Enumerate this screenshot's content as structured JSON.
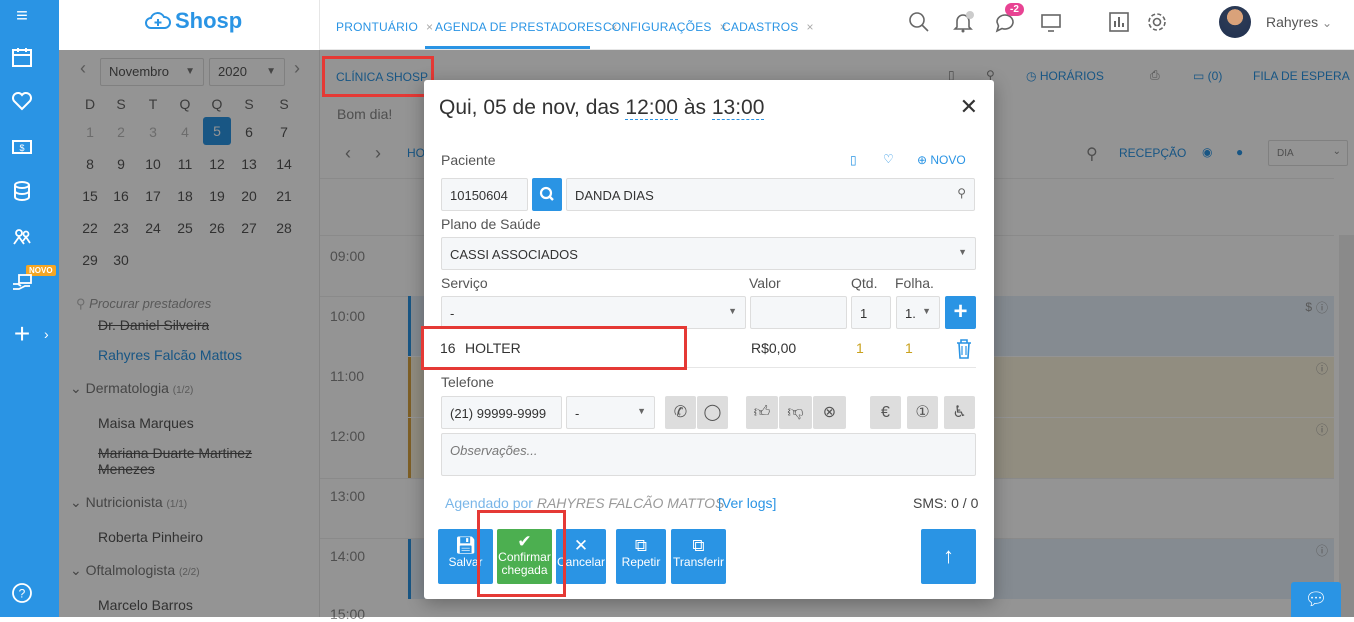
{
  "app": {
    "logo_text": "Shosp",
    "accent": "#2a94e4"
  },
  "rail": {
    "novo_badge": "NOVO"
  },
  "tabs": [
    {
      "label": "PRONTUÁRIO"
    },
    {
      "label": "AGENDA DE PRESTADORES"
    },
    {
      "label": "CONFIGURAÇÕES"
    },
    {
      "label": "CADASTROS"
    }
  ],
  "header": {
    "messages_badge": "-2",
    "user_name": "Rahyres"
  },
  "calendar": {
    "month": "Novembro",
    "year": "2020",
    "weekdays": [
      "D",
      "S",
      "T",
      "Q",
      "Q",
      "S",
      "S"
    ],
    "days": [
      "1",
      "2",
      "3",
      "4",
      "5",
      "6",
      "7",
      "8",
      "9",
      "10",
      "11",
      "12",
      "13",
      "14",
      "15",
      "16",
      "17",
      "18",
      "19",
      "20",
      "21",
      "22",
      "23",
      "24",
      "25",
      "26",
      "27",
      "28",
      "29",
      "30"
    ],
    "selected_day": "5"
  },
  "sidebar": {
    "search_placeholder": "Procurar prestadores",
    "provider_cut": "Dr. Daniel Silveira",
    "provider_active": "Rahyres Falcão Mattos",
    "group1": "Dermatologia",
    "group1_count": "(1/2)",
    "g1_p1": "Maisa Marques",
    "g1_p2": "Mariana Duarte Martinez Menezes",
    "group2": "Nutricionista",
    "group2_count": "(1/1)",
    "g2_p1": "Roberta Pinheiro",
    "group3": "Oftalmologista",
    "group3_count": "(2/2)",
    "g3_p1": "Marcelo Barros"
  },
  "agenda": {
    "clinic": "CLÍNICA SHOSP",
    "greeting": "Bom dia!",
    "ho_label": "HO",
    "horarios": "HORÁRIOS",
    "count": "(0)",
    "fila": "FILA DE ESPERA",
    "recepcao": "RECEPÇÃO",
    "view": "DIA",
    "times": [
      "09:00",
      "10:00",
      "11:00",
      "12:00",
      "13:00",
      "14:00",
      "15:00"
    ],
    "dollar": "$"
  },
  "modal": {
    "title_prefix": "Qui, 05 de nov, das",
    "start": "12:00",
    "middle": "às",
    "end": "13:00",
    "paciente_label": "Paciente",
    "novo": "NOVO",
    "patient_id": "10150604",
    "patient_name": "DANDA DIAS",
    "plano_label": "Plano de Saúde",
    "plano": "CASSI ASSOCIADOS",
    "servico_label": "Serviço",
    "valor_label": "Valor",
    "qtd_label": "Qtd.",
    "folha_label": "Folha.",
    "servico_value": "-",
    "qtd_value": "1",
    "folha_value": "1.",
    "service_row": {
      "code": "16",
      "name": "HOLTER",
      "valor": "R$0,00",
      "qtd": "1",
      "folha": "1"
    },
    "telefone_label": "Telefone",
    "telefone": "(21) 99999-9999",
    "tel_type": "-",
    "obs_placeholder": "Observações...",
    "agendado_prefix": "Agendado por",
    "agendado_by": "RAHYRES FALCÃO MATTOS",
    "ver_logs": "[Ver logs]",
    "sms": "SMS: 0 / 0",
    "buttons": {
      "salvar": "Salvar",
      "confirmar_l1": "Confirmar",
      "confirmar_l2": "chegada",
      "cancelar": "Cancelar",
      "repetir": "Repetir",
      "transferir": "Transferir"
    }
  }
}
